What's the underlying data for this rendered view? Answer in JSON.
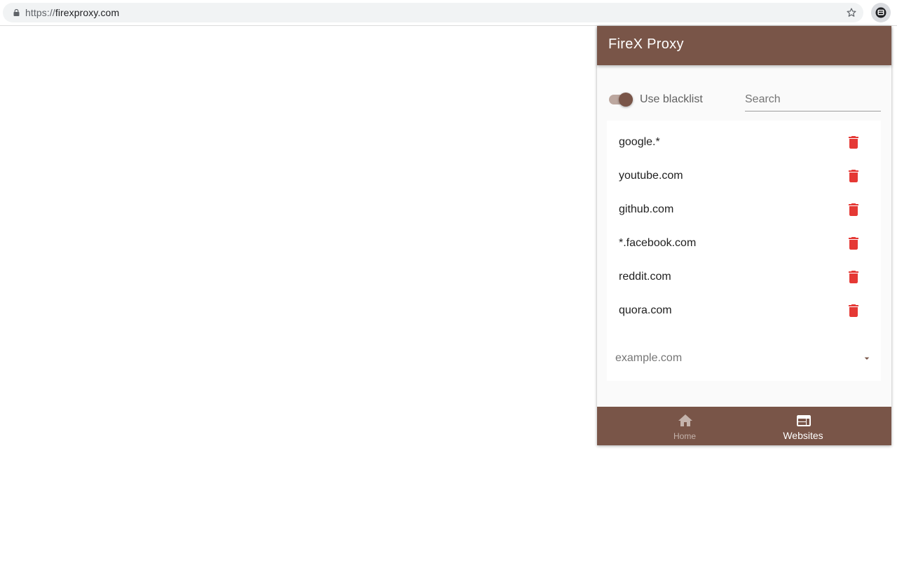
{
  "browser": {
    "url_scheme": "https://",
    "url_host": "firexproxy.com",
    "icons": {
      "lock": "lock-icon",
      "star": "star-icon",
      "extension": "firex-extension-icon"
    }
  },
  "popup": {
    "title": "FireX Proxy",
    "toggle": {
      "label": "Use blacklist",
      "checked": true
    },
    "search": {
      "placeholder": "Search",
      "value": ""
    },
    "sites": [
      {
        "name": "google.*"
      },
      {
        "name": "youtube.com"
      },
      {
        "name": "github.com"
      },
      {
        "name": "*.facebook.com"
      },
      {
        "name": "reddit.com"
      },
      {
        "name": "quora.com"
      }
    ],
    "add_field": {
      "placeholder": "example.com",
      "value": ""
    },
    "nav": [
      {
        "label": "Home",
        "icon": "home-icon",
        "active": false
      },
      {
        "label": "Websites",
        "icon": "web-icon",
        "active": true
      }
    ]
  },
  "colors": {
    "primary": "#795548",
    "delete": "#e53935",
    "toggle_track": "#bca79f",
    "nav_inactive": "#c4b3ac"
  }
}
